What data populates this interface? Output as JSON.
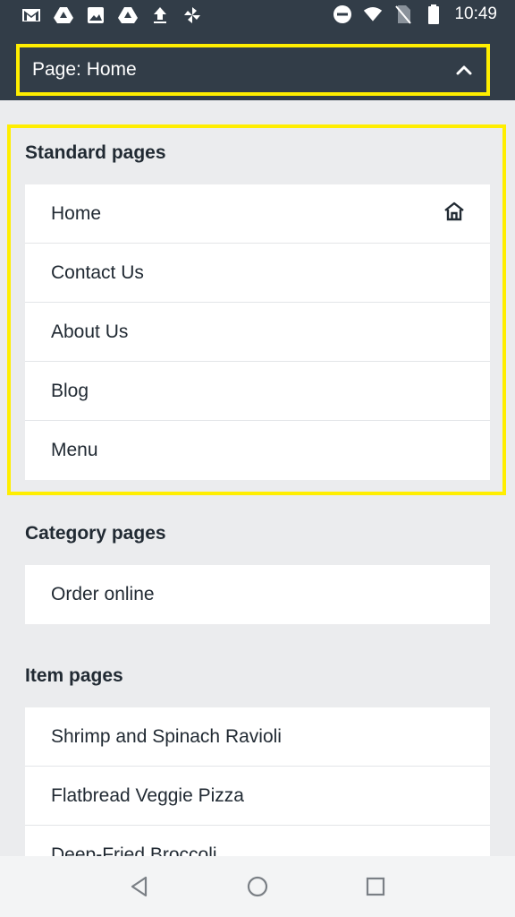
{
  "status_bar": {
    "time": "10:49",
    "left_icons": [
      "gmail-icon",
      "drive-icon",
      "photos-icon",
      "drive-icon",
      "upload-icon",
      "pinwheel-icon"
    ],
    "right_icons": [
      "do-not-disturb-icon",
      "wifi-icon",
      "no-sim-icon",
      "battery-icon"
    ]
  },
  "header": {
    "page_selector_label": "Page: Home",
    "highlight_color": "#ffee00"
  },
  "sections": {
    "standard": {
      "title": "Standard pages",
      "items": [
        {
          "label": "Home",
          "icon": "home-icon"
        },
        {
          "label": "Contact Us"
        },
        {
          "label": "About Us"
        },
        {
          "label": "Blog"
        },
        {
          "label": "Menu"
        }
      ]
    },
    "category": {
      "title": "Category pages",
      "items": [
        {
          "label": "Order online"
        }
      ]
    },
    "item": {
      "title": "Item pages",
      "items": [
        {
          "label": "Shrimp and Spinach Ravioli"
        },
        {
          "label": "Flatbread Veggie Pizza"
        },
        {
          "label": "Deep-Fried Broccoli"
        }
      ]
    }
  },
  "nav_bar": {
    "buttons": [
      "back-icon",
      "home-circle-icon",
      "recents-icon"
    ]
  },
  "colors": {
    "header_bg": "#323d48",
    "page_bg": "#ebecee",
    "text": "#212a33",
    "highlight": "#ffee00"
  }
}
